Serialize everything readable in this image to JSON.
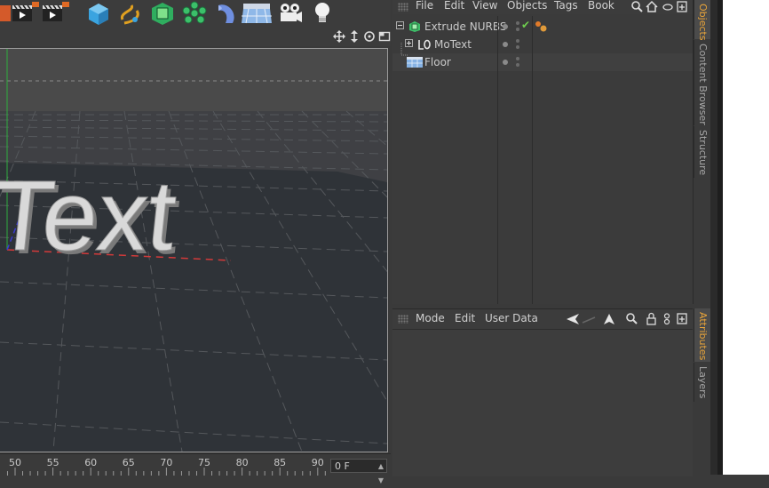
{
  "viewport": {
    "text_object": "Text"
  },
  "timeline": {
    "ticks": [
      "50",
      "55",
      "60",
      "65",
      "70",
      "75",
      "80",
      "85",
      "90"
    ],
    "frame_value": "0 F"
  },
  "object_manager": {
    "menus": [
      "File",
      "Edit",
      "View",
      "Objects",
      "Tags",
      "Book"
    ],
    "objects": [
      {
        "name": "Extrude NURBS",
        "icon": "extrude-nurbs-icon",
        "check": "✔"
      },
      {
        "name": "MoText",
        "icon": "motext-icon"
      },
      {
        "name": "Floor",
        "icon": "floor-icon"
      }
    ]
  },
  "side_tabs_top": [
    "Objects",
    "Content Browser",
    "Structure"
  ],
  "side_tabs_bottom": [
    "Attributes",
    "Layers"
  ],
  "attribute_manager": {
    "menus": [
      "Mode",
      "Edit",
      "User Data"
    ]
  },
  "colors": {
    "accent_tab": "#e8a43a",
    "check": "#6fcf4f",
    "grid_axis_red": "#d23a3a",
    "grid_axis_green": "#2fae3f"
  }
}
